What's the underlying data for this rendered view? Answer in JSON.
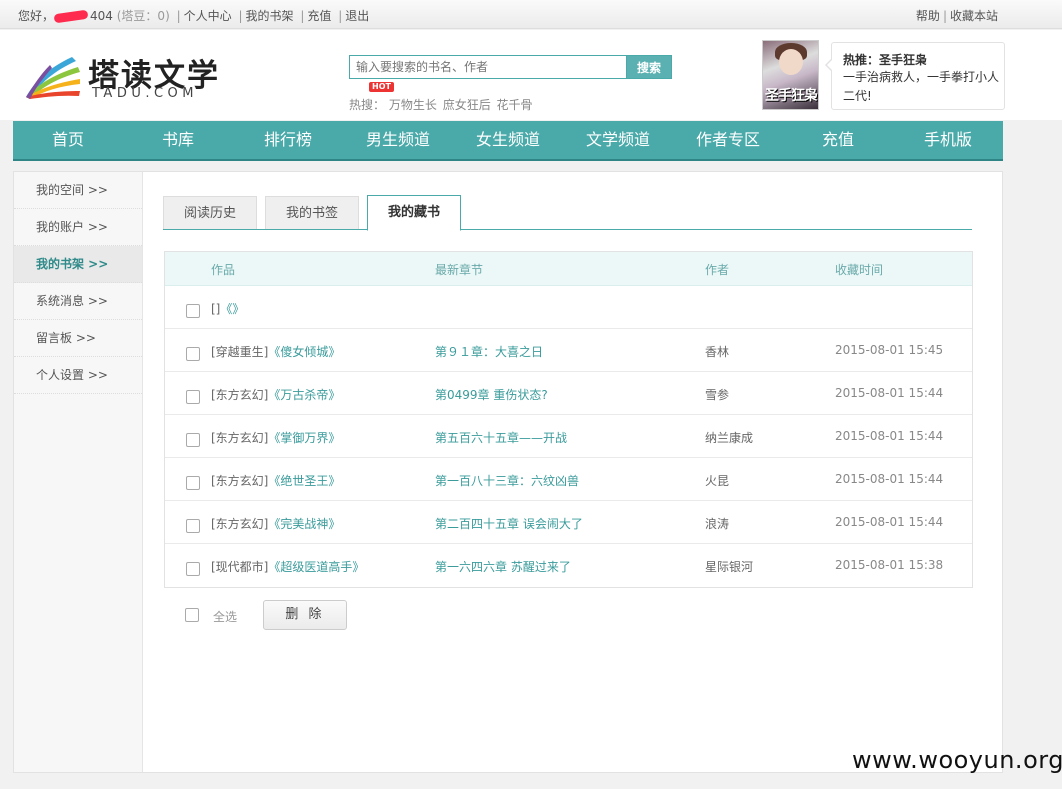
{
  "topbar": {
    "greeting": "您好，",
    "username_visible": "404",
    "beans": "(塔豆：0)",
    "links": [
      "个人中心",
      "我的书架",
      "充值",
      "退出"
    ],
    "right_links": [
      "帮助",
      "收藏本站"
    ]
  },
  "logo": {
    "cn": "塔读文学",
    "en": "TADU.COM"
  },
  "search": {
    "placeholder": "输入要搜索的书名、作者",
    "button": "搜索"
  },
  "hot": {
    "badge": "HOT",
    "label": "热搜：",
    "keywords": [
      "万物生长",
      "庶女狂后",
      "花千骨"
    ]
  },
  "promo": {
    "cover_title": "圣手狂枭",
    "title": "热推：圣手狂枭",
    "desc": "一手治病救人，一手拳打小人二代!"
  },
  "nav": [
    "首页",
    "书库",
    "排行榜",
    "男生频道",
    "女生频道",
    "文学频道",
    "作者专区",
    "充值",
    "手机版"
  ],
  "sidebar": {
    "items": [
      {
        "label": "我的空间 >>"
      },
      {
        "label": "我的账户 >>"
      },
      {
        "label": "我的书架 >>"
      },
      {
        "label": "系统消息 >>"
      },
      {
        "label": "留言板 >>"
      },
      {
        "label": "个人设置 >>"
      }
    ],
    "active": 2
  },
  "tabs": {
    "items": [
      "阅读历史",
      "我的书签",
      "我的藏书"
    ],
    "active": 2
  },
  "table": {
    "headers": [
      "作品",
      "最新章节",
      "作者",
      "收藏时间"
    ],
    "rows": [
      {
        "cat": "[]",
        "book": "《》",
        "chapter": "",
        "author": "",
        "time": ""
      },
      {
        "cat": "[穿越重生]",
        "book": "《傻女倾城》",
        "chapter": "第９１章：大喜之日",
        "author": "香林",
        "time": "2015-08-01 15:45"
      },
      {
        "cat": "[东方玄幻]",
        "book": "《万古杀帝》",
        "chapter": "第0499章 重伤状态?",
        "author": "雪参",
        "time": "2015-08-01 15:44"
      },
      {
        "cat": "[东方玄幻]",
        "book": "《掌御万界》",
        "chapter": "第五百六十五章——开战",
        "author": "纳兰康成",
        "time": "2015-08-01 15:44"
      },
      {
        "cat": "[东方玄幻]",
        "book": "《绝世圣王》",
        "chapter": "第一百八十三章：六纹凶兽",
        "author": "火昆",
        "time": "2015-08-01 15:44"
      },
      {
        "cat": "[东方玄幻]",
        "book": "《完美战神》",
        "chapter": "第二百四十五章 误会闹大了",
        "author": "浪涛",
        "time": "2015-08-01 15:44"
      },
      {
        "cat": "[现代都市]",
        "book": "《超级医道高手》",
        "chapter": "第一六四六章 苏醒过来了",
        "author": "星际银河",
        "time": "2015-08-01 15:38"
      }
    ]
  },
  "actions": {
    "select_all": "全选",
    "delete": "删 除"
  },
  "watermark": "www.wooyun.org",
  "colors": {
    "accent": "#4aa9a9",
    "link": "#3a9b9b",
    "hot_badge": "#ee3333"
  }
}
